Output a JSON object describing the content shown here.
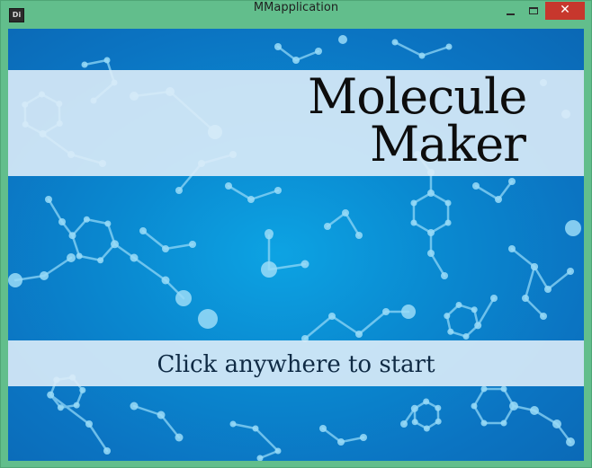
{
  "window": {
    "title": "MMapplication",
    "icon_label": "Di",
    "close_glyph": "✕"
  },
  "splash": {
    "title_line1": "Molecule",
    "title_line2": "Maker",
    "prompt": "Click anywhere to start"
  },
  "colors": {
    "titlebar": "#62be8c",
    "close_button": "#c7372d",
    "background_blue": "#0b74c2",
    "band": "#dcecf8",
    "logo_text": "#0d0d0d"
  }
}
